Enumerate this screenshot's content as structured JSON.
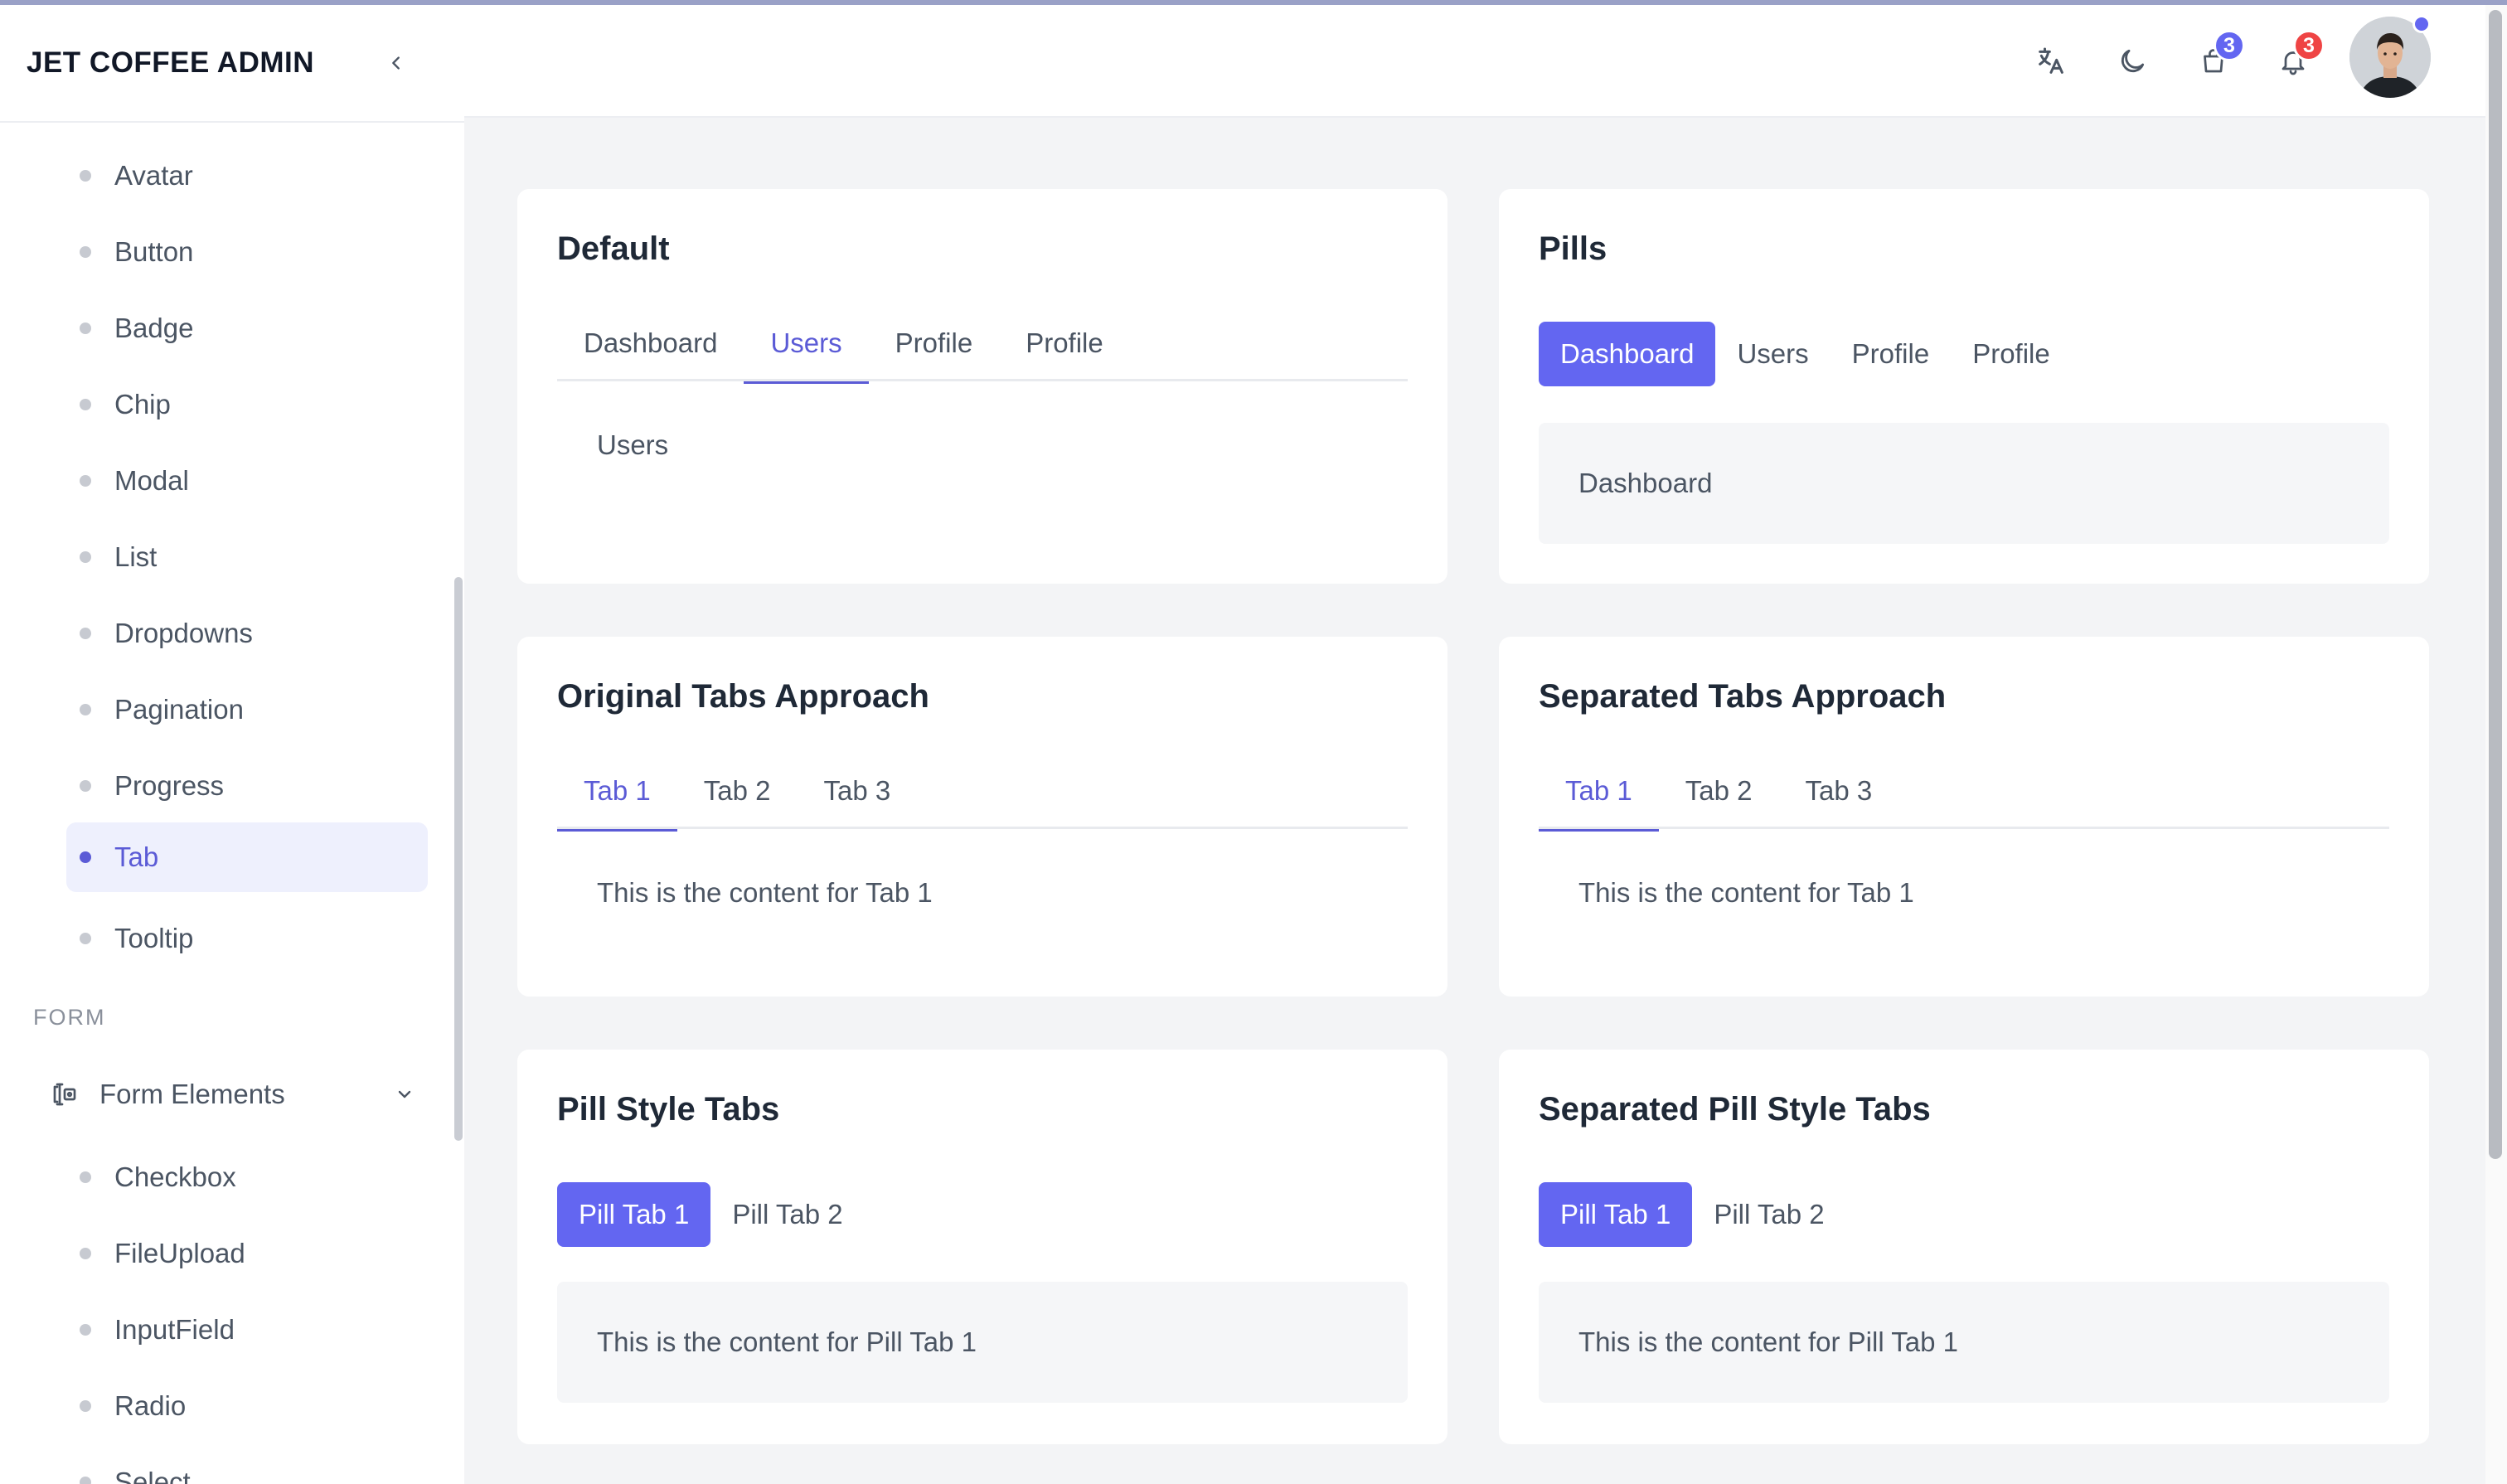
{
  "sidebar": {
    "brand": "JET COFFEE ADMIN",
    "items": [
      {
        "label": "Avatar"
      },
      {
        "label": "Button"
      },
      {
        "label": "Badge"
      },
      {
        "label": "Chip"
      },
      {
        "label": "Modal"
      },
      {
        "label": "List"
      },
      {
        "label": "Dropdowns"
      },
      {
        "label": "Pagination"
      },
      {
        "label": "Progress"
      },
      {
        "label": "Tab",
        "active": true
      },
      {
        "label": "Tooltip"
      }
    ],
    "section_form": "FORM",
    "form_group": "Form Elements",
    "form_items": [
      {
        "label": "Checkbox"
      },
      {
        "label": "FileUpload"
      },
      {
        "label": "InputField"
      },
      {
        "label": "Radio"
      },
      {
        "label": "Select"
      }
    ]
  },
  "topbar": {
    "icons": [
      "translate-icon",
      "moon-icon",
      "shopping-bag-icon",
      "bell-icon"
    ],
    "cart_badge": "3",
    "notification_badge": "3",
    "colors": {
      "cart_badge": "#6366f1",
      "notification_badge": "#ef4444"
    }
  },
  "cards": {
    "default": {
      "title": "Default",
      "tabs": [
        "Dashboard",
        "Users",
        "Profile",
        "Profile"
      ],
      "active_index": 1,
      "content": "Users"
    },
    "pills": {
      "title": "Pills",
      "tabs": [
        "Dashboard",
        "Users",
        "Profile",
        "Profile"
      ],
      "active_index": 0,
      "content": "Dashboard"
    },
    "original": {
      "title": "Original Tabs Approach",
      "tabs": [
        "Tab 1",
        "Tab 2",
        "Tab 3"
      ],
      "active_index": 0,
      "content": "This is the content for Tab 1"
    },
    "separated": {
      "title": "Separated Tabs Approach",
      "tabs": [
        "Tab 1",
        "Tab 2",
        "Tab 3"
      ],
      "active_index": 0,
      "content": "This is the content for Tab 1"
    },
    "pill_style": {
      "title": "Pill Style Tabs",
      "tabs": [
        "Pill Tab 1",
        "Pill Tab 2"
      ],
      "active_index": 0,
      "content": "This is the content for Pill Tab 1"
    },
    "separated_pill": {
      "title": "Separated Pill Style Tabs",
      "tabs": [
        "Pill Tab 1",
        "Pill Tab 2"
      ],
      "active_index": 0,
      "content": "This is the content for Pill Tab 1"
    }
  },
  "colors": {
    "accent": "#6366f1",
    "accent_text": "#5b5bd6",
    "background": "#f3f4f6"
  }
}
